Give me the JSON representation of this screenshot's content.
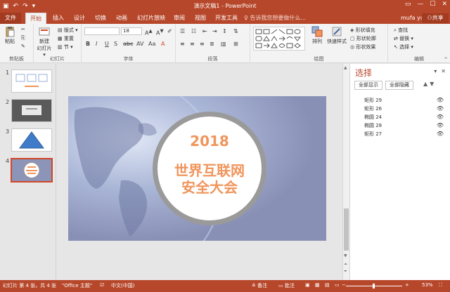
{
  "window": {
    "title": "演示文稿1 - PowerPoint"
  },
  "tabs": [
    "文件",
    "开始",
    "插入",
    "设计",
    "切换",
    "动画",
    "幻灯片放映",
    "审阅",
    "视图",
    "开发工具"
  ],
  "tell_me": "告诉我您想要做什么...",
  "account": "mufa yu",
  "share": "共享",
  "ribbon": {
    "clipboard": {
      "paste": "粘贴",
      "label": "剪贴板"
    },
    "slides": {
      "new_slide": "新建\n幻灯片",
      "layout": "版式",
      "reset": "重置",
      "section": "节",
      "label": "幻灯片"
    },
    "font": {
      "label": "字体",
      "size": "18"
    },
    "paragraph": {
      "label": "段落"
    },
    "drawing": {
      "arrange": "排列",
      "quick_styles": "快速样式",
      "shape_fill": "形状填充",
      "shape_outline": "形状轮廓",
      "shape_effects": "形状效果",
      "label": "绘图"
    },
    "editing": {
      "find": "查找",
      "replace": "替换",
      "select": "选择",
      "label": "编辑"
    }
  },
  "thumbnails": [
    {
      "num": "1"
    },
    {
      "num": "2"
    },
    {
      "num": "3"
    },
    {
      "num": "4"
    }
  ],
  "slide": {
    "year": "2018",
    "title_line1": "世界互联网",
    "title_line2": "安全大会"
  },
  "selection_pane": {
    "title": "选择",
    "show_all": "全部显示",
    "hide_all": "全部隐藏",
    "items": [
      {
        "label": "矩形 29"
      },
      {
        "label": "矩形 26"
      },
      {
        "label": "椭圆 24"
      },
      {
        "label": "椭圆 28"
      },
      {
        "label": "矩形 27"
      }
    ]
  },
  "status": {
    "slide_info": "幻灯片 第 4 张，共 4 张",
    "theme": "\"Office 主题\"",
    "language": "中文(中国)",
    "notes": "备注",
    "comments": "批注",
    "zoom": "53%"
  },
  "colors": {
    "accent": "#b7472a",
    "slide_text": "#f0955c",
    "circle_ring": "#9a9a9a"
  }
}
